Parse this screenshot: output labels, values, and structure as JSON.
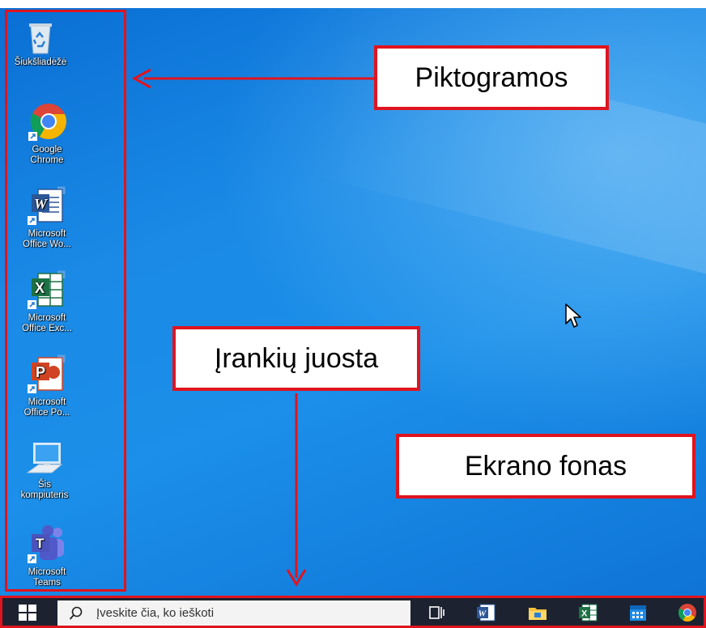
{
  "desktop_icons": [
    {
      "label": "Šiukšliadėžė",
      "icon": "recycle-bin-icon"
    },
    {
      "label": "Google\nChrome",
      "icon": "chrome-icon"
    },
    {
      "label": "Microsoft\nOffice Wo...",
      "icon": "word-icon"
    },
    {
      "label": "Microsoft\nOffice Exc...",
      "icon": "excel-icon"
    },
    {
      "label": "Microsoft\nOffice Po...",
      "icon": "powerpoint-icon"
    },
    {
      "label": "Šis\nkompiuteris",
      "icon": "this-pc-icon"
    },
    {
      "label": "Microsoft\nTeams",
      "icon": "teams-icon"
    }
  ],
  "callouts": {
    "icons": "Piktogramos",
    "taskbar": "Įrankių juosta",
    "background": "Ekrano fonas"
  },
  "taskbar": {
    "search_placeholder": "Įveskite čia, ko ieškoti",
    "items": [
      "task-view-icon",
      "word-icon",
      "file-explorer-icon",
      "excel-icon",
      "calendar-icon",
      "chrome-icon"
    ]
  },
  "colors": {
    "annotation_red": "#e0141e",
    "desktop_blue": "#1a8ae6",
    "taskbar": "#1c2230"
  }
}
